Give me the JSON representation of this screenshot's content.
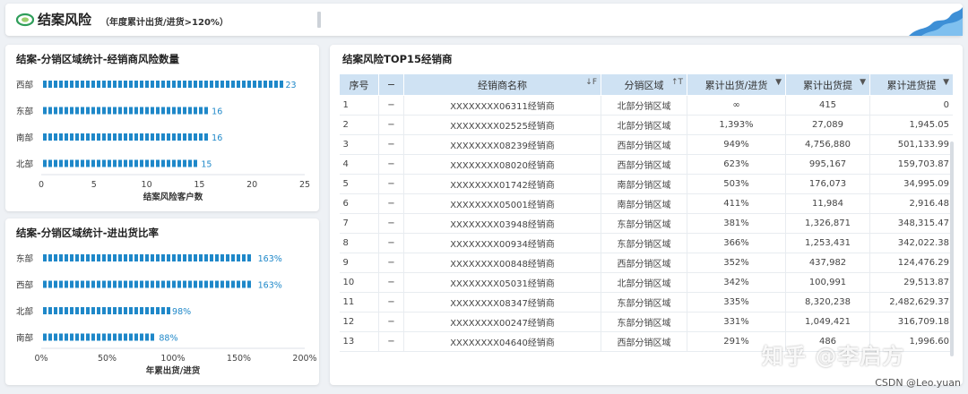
{
  "header": {
    "title": "结案风险",
    "subtitle": "（年度累计出货/进货>120%）"
  },
  "chart1": {
    "title": "结案-分销区域统计-经销商风险数量"
  },
  "chart2": {
    "title": "结案-分销区域统计-进出货比率"
  },
  "chart_data": [
    {
      "type": "bar",
      "orientation": "horizontal",
      "title": "结案-分销区域统计-经销商风险数量",
      "categories": [
        "西部",
        "东部",
        "南部",
        "北部"
      ],
      "values": [
        23,
        16,
        16,
        15
      ],
      "value_labels": [
        "23",
        "16",
        "16",
        "15"
      ],
      "xlabel": "结案风险客户数",
      "ylabel": "",
      "xlim": [
        0,
        25
      ],
      "xticks": [
        "0",
        "5",
        "10",
        "15",
        "20",
        "25"
      ],
      "bar_color": "#1f88c9"
    },
    {
      "type": "bar",
      "orientation": "horizontal",
      "title": "结案-分销区域统计-进出货比率",
      "categories": [
        "东部",
        "西部",
        "北部",
        "南部"
      ],
      "values": [
        163,
        163,
        98,
        88
      ],
      "value_labels": [
        "163%",
        "163%",
        "98%",
        "88%"
      ],
      "xlabel": "年累出货/进货",
      "ylabel": "",
      "xlim": [
        0,
        200
      ],
      "xticks": [
        "0%",
        "50%",
        "100%",
        "150%",
        "200%"
      ],
      "bar_color": "#1f88c9"
    }
  ],
  "table": {
    "title": "结案风险TOP15经销商",
    "columns": [
      {
        "label": "序号",
        "sort": ""
      },
      {
        "label": "−",
        "sort": ""
      },
      {
        "label": "经销商名称",
        "sort": "↓F"
      },
      {
        "label": "分销区域",
        "sort": "↑T"
      },
      {
        "label": "累计出货/进货",
        "sort": "▼"
      },
      {
        "label": "累计出货提",
        "sort": "▼"
      },
      {
        "label": "累计进货提",
        "sort": "▼"
      }
    ],
    "rows": [
      [
        "1",
        "−",
        "XXXXXXXX06311经销商",
        "北部分销区域",
        "∞",
        "415",
        "0"
      ],
      [
        "2",
        "−",
        "XXXXXXXX02525经销商",
        "北部分销区域",
        "1,393%",
        "27,089",
        "1,945.05"
      ],
      [
        "3",
        "−",
        "XXXXXXXX08239经销商",
        "西部分销区域",
        "949%",
        "4,756,880",
        "501,133.99"
      ],
      [
        "4",
        "−",
        "XXXXXXXX08020经销商",
        "西部分销区域",
        "623%",
        "995,167",
        "159,703.87"
      ],
      [
        "5",
        "−",
        "XXXXXXXX01742经销商",
        "南部分销区域",
        "503%",
        "176,073",
        "34,995.09"
      ],
      [
        "6",
        "−",
        "XXXXXXXX05001经销商",
        "南部分销区域",
        "411%",
        "11,984",
        "2,916.48"
      ],
      [
        "7",
        "−",
        "XXXXXXXX03948经销商",
        "东部分销区域",
        "381%",
        "1,326,871",
        "348,315.47"
      ],
      [
        "8",
        "−",
        "XXXXXXXX00934经销商",
        "东部分销区域",
        "366%",
        "1,253,431",
        "342,022.38"
      ],
      [
        "9",
        "−",
        "XXXXXXXX00848经销商",
        "西部分销区域",
        "352%",
        "437,982",
        "124,476.29"
      ],
      [
        "10",
        "−",
        "XXXXXXXX05031经销商",
        "北部分销区域",
        "342%",
        "100,991",
        "29,513.87"
      ],
      [
        "11",
        "−",
        "XXXXXXXX08347经销商",
        "东部分销区域",
        "335%",
        "8,320,238",
        "2,482,629.37"
      ],
      [
        "12",
        "−",
        "XXXXXXXX00247经销商",
        "东部分销区域",
        "331%",
        "1,049,421",
        "316,709.18"
      ],
      [
        "13",
        "−",
        "XXXXXXXX04640经销商",
        "西部分销区域",
        "291%",
        "486",
        "1,996.60"
      ]
    ]
  },
  "watermark": "知乎 @李启方",
  "credit": "CSDN @Leo.yuan"
}
